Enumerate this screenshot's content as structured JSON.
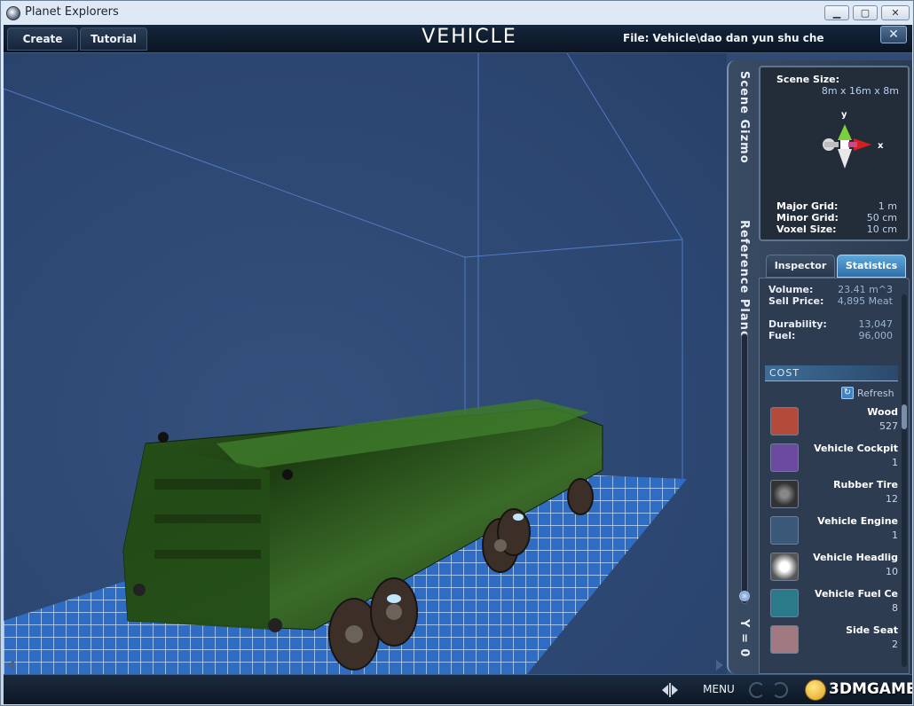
{
  "window": {
    "title": "Planet Explorers",
    "minimize": "▁",
    "maximize": "▢",
    "close": "✕"
  },
  "topbar": {
    "tabs": [
      {
        "label": "Create"
      },
      {
        "label": "Tutorial"
      }
    ],
    "mode_title": "VEHICLE",
    "file_label": "File:  Vehicle\\dao dan yun shu che",
    "close_icon": "✕"
  },
  "side": {
    "scene_gizmo_label": "Scene Gizmo",
    "reference_plane_label": "Reference Plane",
    "y_label": "Y = 0",
    "reference_plane_level": 0.0
  },
  "gizmo": {
    "scene_size_label": "Scene Size:",
    "scene_size_value": "8m x 16m x 8m",
    "axis_y": "y",
    "axis_x": "x",
    "major_grid_label": "Major Grid:",
    "major_grid_value": "1 m",
    "minor_grid_label": "Minor Grid:",
    "minor_grid_value": "50 cm",
    "voxel_size_label": "Voxel Size:",
    "voxel_size_value": "10 cm"
  },
  "panel_tabs": {
    "inspector": "Inspector",
    "statistics": "Statistics"
  },
  "stats": {
    "volume_label": "Volume:",
    "volume_value": "23.41 m^3",
    "sell_price_label": "Sell Price:",
    "sell_price_value": "4,895 Meat",
    "durability_label": "Durability:",
    "durability_value": "13,047",
    "fuel_label": "Fuel:",
    "fuel_value": "96,000",
    "cost_header": "COST",
    "refresh_label": "Refresh",
    "cost_items": [
      {
        "name": "Wood",
        "qty": "527",
        "icon": "wood-icon",
        "color": "#b34a3a"
      },
      {
        "name": "Vehicle Cockpit",
        "qty": "1",
        "icon": "cockpit-icon",
        "color": "#6b4aa0"
      },
      {
        "name": "Rubber Tire",
        "qty": "12",
        "icon": "tire-icon",
        "color": "#555555"
      },
      {
        "name": "Vehicle Engine",
        "qty": "1",
        "icon": "engine-icon",
        "color": "#3a5878"
      },
      {
        "name": "Vehicle Headlig",
        "qty": "10",
        "icon": "headlight-icon",
        "color": "#c8d0da"
      },
      {
        "name": "Vehicle Fuel Ce",
        "qty": "8",
        "icon": "fuel-cell-icon",
        "color": "#2a7a8a"
      },
      {
        "name": "Side Seat",
        "qty": "2",
        "icon": "seat-icon",
        "color": "#a07a80"
      }
    ]
  },
  "bottombar": {
    "menu_label": "MENU",
    "watermark": "3DMGAME"
  }
}
